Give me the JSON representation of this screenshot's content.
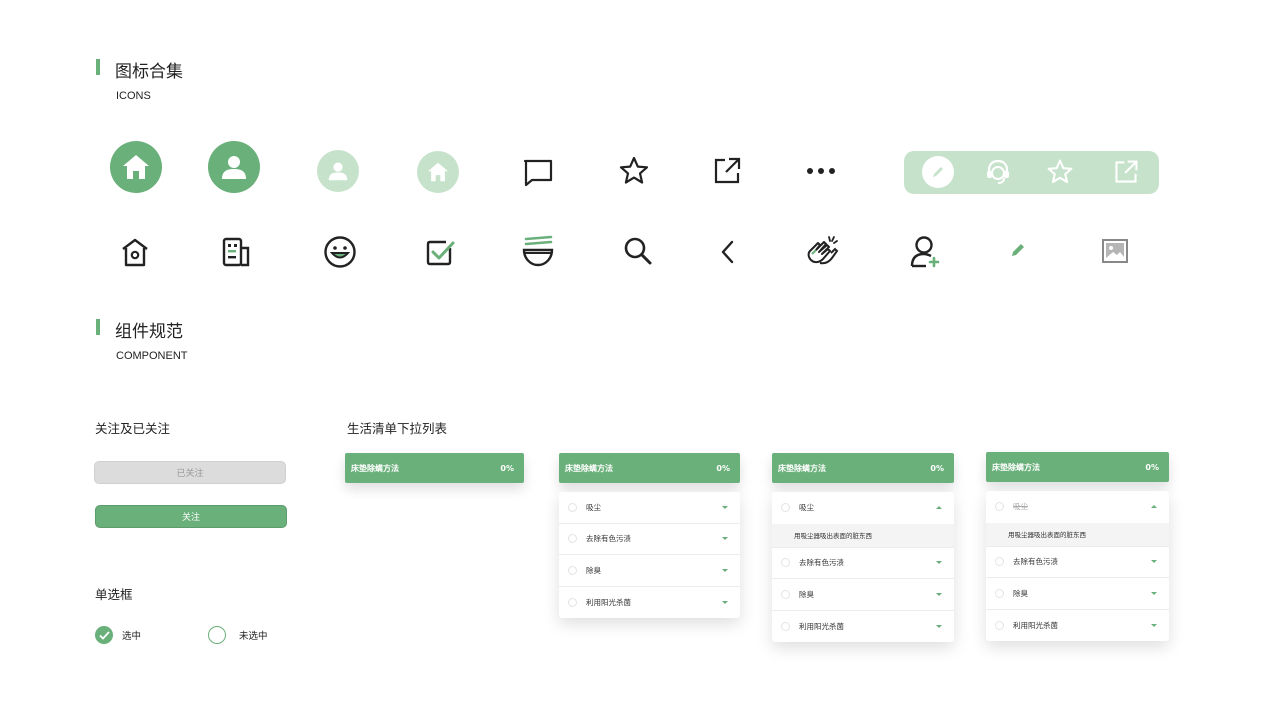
{
  "icons_section": {
    "title": "图标合集",
    "subtitle": "ICONS"
  },
  "component_section": {
    "title": "组件规范",
    "subtitle": "COMPONENT"
  },
  "icons_row1": [
    "home-circle-icon",
    "user-circle-icon",
    "user-circle-light-icon",
    "home-circle-light-icon",
    "message-icon",
    "star-icon",
    "external-link-icon",
    "more-icon"
  ],
  "icons_pill": [
    "edit-icon",
    "customer-service-icon",
    "star-icon",
    "external-link-icon"
  ],
  "icons_row2": [
    "house-icon",
    "building-icon",
    "smile-icon",
    "checkbox-icon",
    "bowl-icon",
    "search-icon",
    "back-icon",
    "clap-icon",
    "add-user-icon",
    "pencil-icon",
    "image-icon"
  ],
  "colors": {
    "accent": "#6ab07a",
    "accent_light": "#c6e2cb",
    "disabled_bg": "#dcdcdc"
  },
  "follow": {
    "title": "关注及已关注",
    "followed_label": "已关注",
    "follow_label": "关注"
  },
  "radio": {
    "title": "单选框",
    "checked_label": "选中",
    "unchecked_label": "未选中"
  },
  "dropdown": {
    "title": "生活清单下拉列表",
    "header": "床垫除螨方法",
    "percent": "0%",
    "items": [
      "吸尘",
      "去除有色污渍",
      "除臭",
      "利用阳光杀菌"
    ],
    "detail": "用吸尘器吸出表面的脏东西"
  }
}
